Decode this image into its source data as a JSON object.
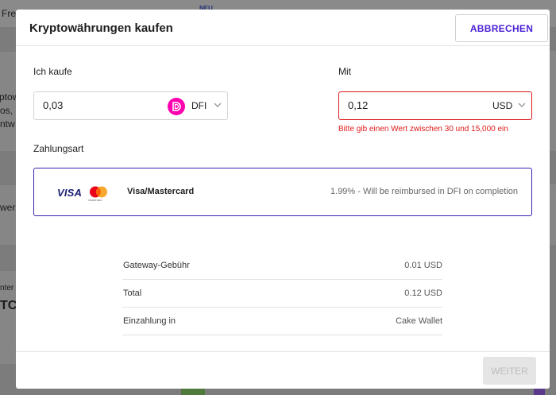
{
  "background": {
    "nav_fragment": "Fre",
    "new_badge": "NEU",
    "text_fragments": [
      "ptow",
      "os, i",
      "ntw",
      "wer",
      "nter",
      "TC"
    ]
  },
  "modal": {
    "title": "Kryptowährungen kaufen",
    "cancel_label": "ABBRECHEN",
    "buy": {
      "label": "Ich kaufe",
      "value": "0,03",
      "currency": "DFI",
      "coin_icon": "defichain-icon"
    },
    "pay_with": {
      "label": "Mit",
      "value": "0,12",
      "currency": "USD",
      "error": "Bitte gib einen Wert zwischen 30 und 15,000 ein"
    },
    "payment_method": {
      "label": "Zahlungsart",
      "visa_text": "VISA",
      "mastercard_caption": "mastercard",
      "name": "Visa/Mastercard",
      "fee_note": "1.99% - Will be reimbursed in DFI on completion"
    },
    "summary": [
      {
        "key": "Gateway-Gebühr",
        "value": "0.01 USD"
      },
      {
        "key": "Total",
        "value": "0.12 USD"
      },
      {
        "key": "Einzahlung in",
        "value": "Cake Wallet"
      }
    ],
    "next_label": "WEITER"
  },
  "colors": {
    "accent": "#4b21d6",
    "error": "#e01a1a",
    "dfi_pink": "#ff00af",
    "disabled_bg": "#e5e5e5"
  }
}
